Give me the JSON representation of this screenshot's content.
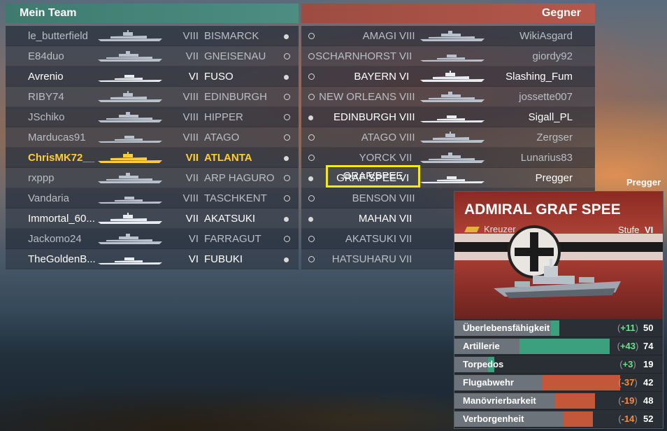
{
  "my_team_label": "Mein Team",
  "enemy_team_label": "Gegner",
  "my_team": [
    {
      "player": "le_butterfield",
      "tier": "VIII",
      "ship": "BISMARCK",
      "style": "dim"
    },
    {
      "player": "E84duo",
      "tier": "VII",
      "ship": "GNEISENAU",
      "style": "dim"
    },
    {
      "player": "Avrenio",
      "tier": "VI",
      "ship": "FUSO",
      "style": "bright"
    },
    {
      "player": "RIBY74",
      "tier": "VIII",
      "ship": "EDINBURGH",
      "style": "dim"
    },
    {
      "player": "JSchiko",
      "tier": "VIII",
      "ship": "HIPPER",
      "style": "dim"
    },
    {
      "player": "Marducas91",
      "tier": "VIII",
      "ship": "ATAGO",
      "style": "dim"
    },
    {
      "player": "ChrisMK72__",
      "tier": "VII",
      "ship": "ATLANTA",
      "style": "gold"
    },
    {
      "player": "rxppp",
      "tier": "VII",
      "ship": "ARP HAGURO",
      "style": "dim"
    },
    {
      "player": "Vandaria",
      "tier": "VIII",
      "ship": "TASCHKENT",
      "style": "dim"
    },
    {
      "player": "Immortal_60...",
      "tier": "VII",
      "ship": "AKATSUKI",
      "style": "bright"
    },
    {
      "player": "Jackomo24",
      "tier": "VI",
      "ship": "FARRAGUT",
      "style": "dim"
    },
    {
      "player": "TheGoldenB...",
      "tier": "VI",
      "ship": "FUBUKI",
      "style": "bright"
    }
  ],
  "enemy_team": [
    {
      "player": "WikiAsgard",
      "tier": "VIII",
      "ship": "AMAGI",
      "style": "dim"
    },
    {
      "player": "giordy92",
      "tier": "VII",
      "ship": "SCHARNHORST",
      "style": "dim"
    },
    {
      "player": "Slashing_Fum",
      "tier": "VI",
      "ship": "BAYERN",
      "style": "bright"
    },
    {
      "player": "jossette007",
      "tier": "VIII",
      "ship": "NEW ORLEANS",
      "style": "dim"
    },
    {
      "player": "Sigall_PL",
      "tier": "VIII",
      "ship": "EDINBURGH",
      "style": "bright"
    },
    {
      "player": "Zergser",
      "tier": "VIII",
      "ship": "ATAGO",
      "style": "dim"
    },
    {
      "player": "Lunarius83",
      "tier": "VII",
      "ship": "YORCK",
      "style": "dim"
    },
    {
      "player": "Pregger",
      "tier": "VI",
      "ship": "GRAF SPEE",
      "style": "bright"
    },
    {
      "player": "",
      "tier": "VIII",
      "ship": "BENSON",
      "style": "dim"
    },
    {
      "player": "",
      "tier": "VII",
      "ship": "MAHAN",
      "style": "bright"
    },
    {
      "player": "",
      "tier": "VII",
      "ship": "AKATSUKI",
      "style": "dim"
    },
    {
      "player": "",
      "tier": "VII",
      "ship": "HATSUHARU",
      "style": "dim"
    }
  ],
  "my_dots": [
    "filled",
    "hollow",
    "filled",
    "hollow",
    "hollow",
    "hollow",
    "filled",
    "hollow",
    "hollow",
    "filled",
    "hollow",
    "filled"
  ],
  "enemy_dots": [
    "hollow",
    "hollow",
    "hollow",
    "hollow",
    "filled",
    "hollow",
    "hollow",
    "filled",
    "hollow",
    "filled",
    "hollow",
    "hollow"
  ],
  "highlight": {
    "ship": "GRAF SPEE",
    "tier": "VI"
  },
  "tooltip": {
    "owner": "Pregger",
    "title": "ADMIRAL GRAF SPEE",
    "class": "Kreuzer",
    "tier_label": "Stufe",
    "tier": "VI",
    "stats": [
      {
        "name": "Überlebensfähigkeit",
        "delta": "+11",
        "value": "50",
        "sign": "plus",
        "base": 0.46,
        "total": 0.5
      },
      {
        "name": "Artillerie",
        "delta": "+43",
        "value": "74",
        "sign": "plus",
        "base": 0.31,
        "total": 0.74
      },
      {
        "name": "Torpedos",
        "delta": "+3",
        "value": "19",
        "sign": "plus",
        "base": 0.16,
        "total": 0.19
      },
      {
        "name": "Flugabwehr",
        "delta": "-37",
        "value": "42",
        "sign": "minus",
        "base": 0.42,
        "total": 0.79
      },
      {
        "name": "Manövrierbarkeit",
        "delta": "-19",
        "value": "48",
        "sign": "minus",
        "base": 0.48,
        "total": 0.67
      },
      {
        "name": "Verborgenheit",
        "delta": "-14",
        "value": "52",
        "sign": "minus",
        "base": 0.52,
        "total": 0.66
      }
    ]
  }
}
